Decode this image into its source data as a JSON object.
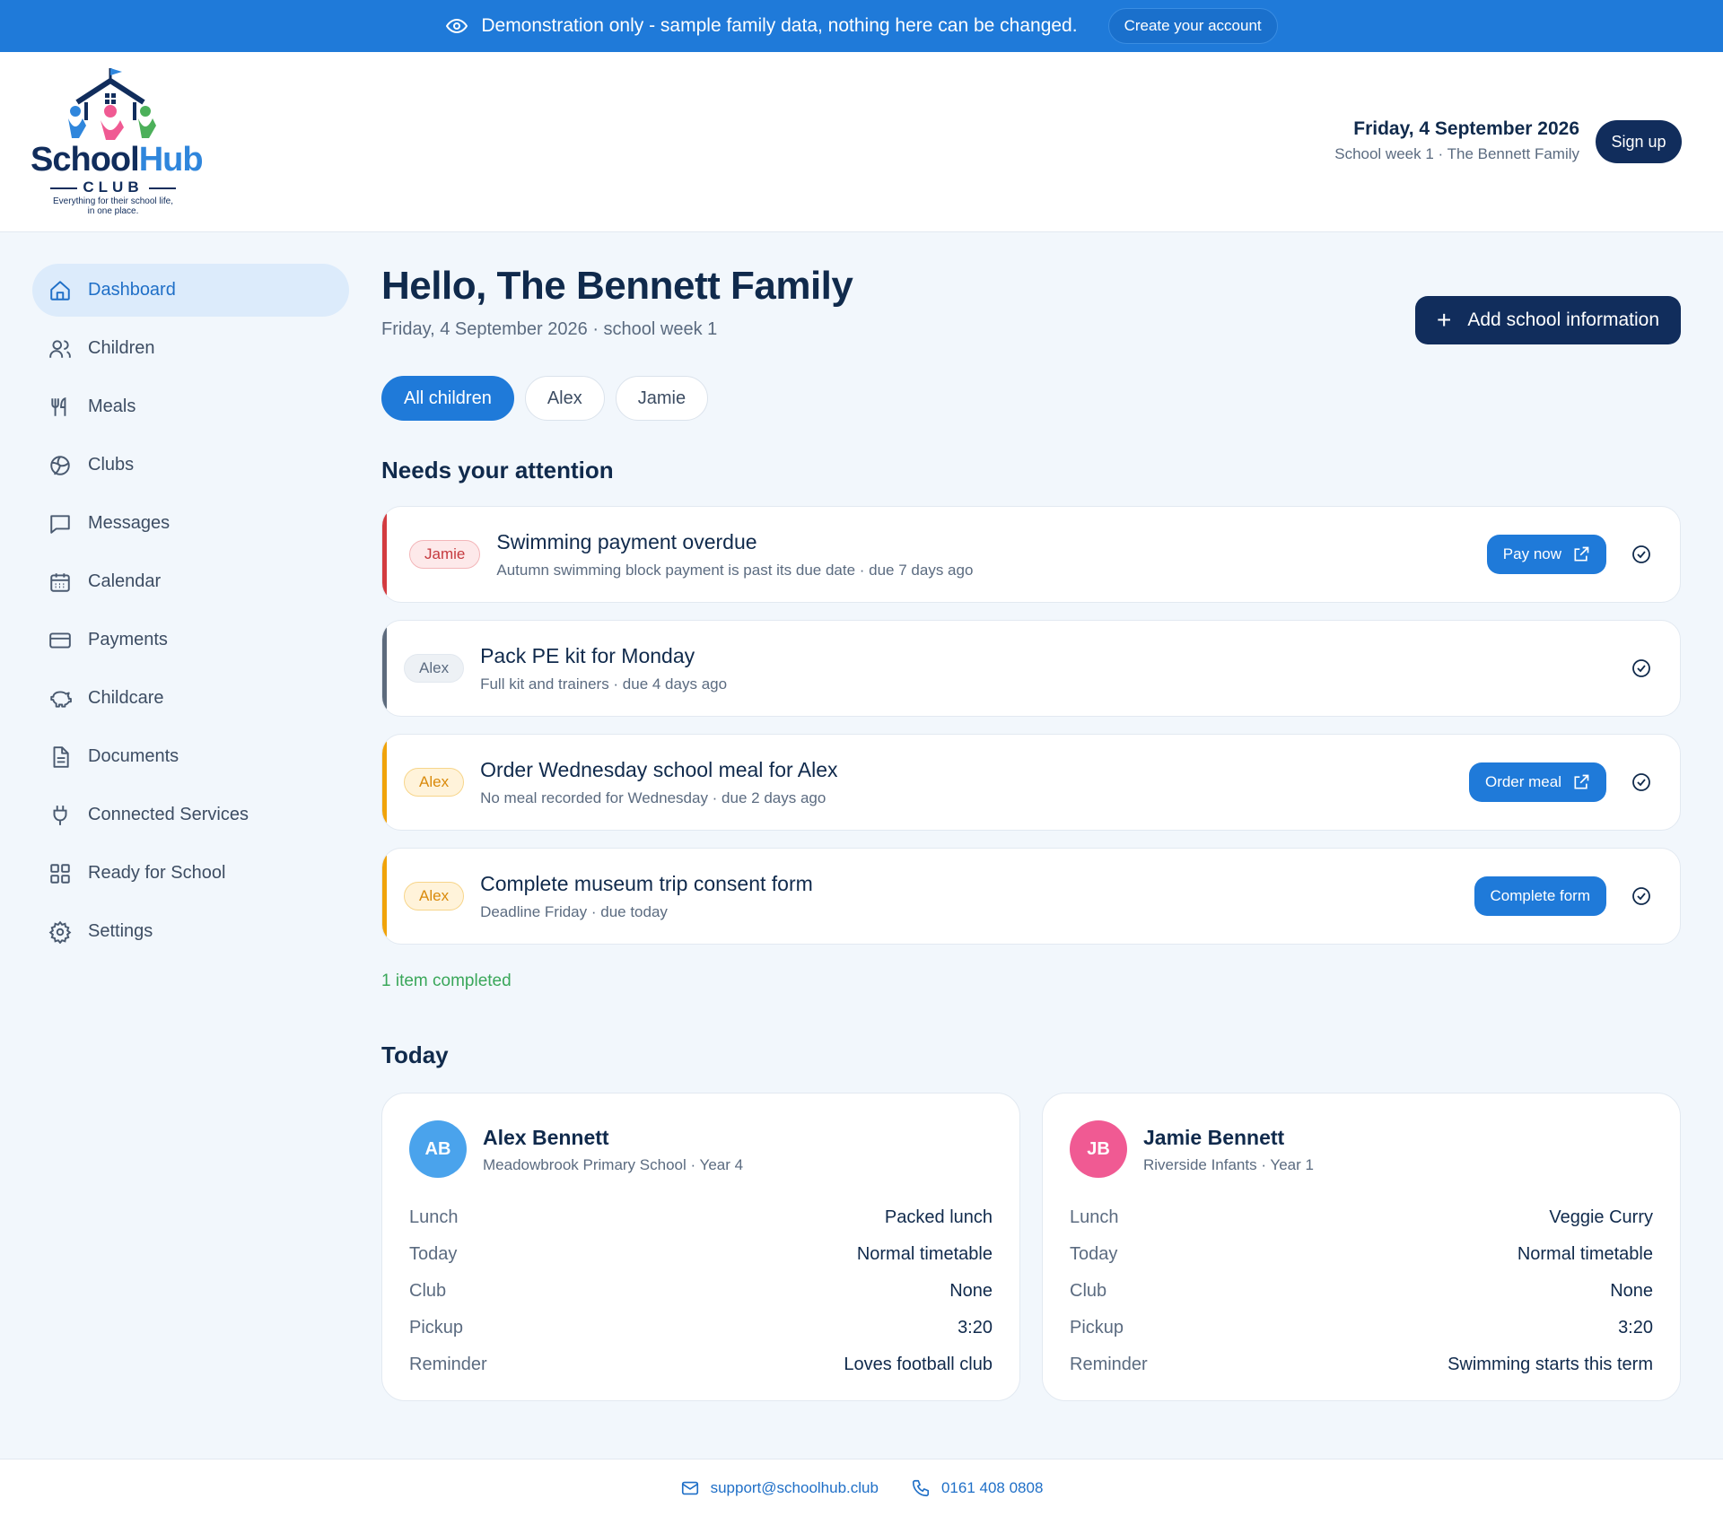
{
  "colors": {
    "banner": "#1f7ad9",
    "navy": "#112d5c",
    "accent": "#1f7ad9",
    "urgent": "#d33b40",
    "normal": "#5d6b7d",
    "warning": "#f0a30a",
    "success": "#3aa75a",
    "avatar_alex": "#4aa3ec",
    "avatar_jamie": "#f05a93"
  },
  "banner": {
    "icon": "eye-icon",
    "text": "Demonstration only - sample family data, nothing here can be changed.",
    "cta": "Create your account"
  },
  "logo": {
    "brand_a": "School",
    "brand_b": "Hub",
    "club": "CLUB",
    "tagline_line1": "Everything for their school life,",
    "tagline_line2": "in one place."
  },
  "header": {
    "date": "Friday, 4 September 2026",
    "subtitle": "School week 1 · The Bennett Family",
    "signup": "Sign up"
  },
  "sidebar": {
    "items": [
      {
        "label": "Dashboard",
        "icon": "home-icon"
      },
      {
        "label": "Children",
        "icon": "users-icon"
      },
      {
        "label": "Meals",
        "icon": "utensils-icon"
      },
      {
        "label": "Clubs",
        "icon": "ball-icon"
      },
      {
        "label": "Messages",
        "icon": "message-icon"
      },
      {
        "label": "Calendar",
        "icon": "calendar-icon"
      },
      {
        "label": "Payments",
        "icon": "card-icon"
      },
      {
        "label": "Childcare",
        "icon": "piggy-icon"
      },
      {
        "label": "Documents",
        "icon": "document-icon"
      },
      {
        "label": "Connected Services",
        "icon": "plug-icon"
      },
      {
        "label": "Ready for School",
        "icon": "grid-icon"
      },
      {
        "label": "Settings",
        "icon": "gear-icon"
      }
    ]
  },
  "main": {
    "greeting": "Hello, The Bennett Family",
    "date_line": "Friday, 4 September 2026 · school week 1",
    "add_button": "Add school information",
    "filters": [
      "All children",
      "Alex",
      "Jamie"
    ],
    "attention_title": "Needs your attention",
    "tasks": [
      {
        "child": "Jamie",
        "title": "Swimming payment overdue",
        "detail": "Autumn swimming block payment is past its due date · due 7 days ago",
        "action": "Pay now"
      },
      {
        "child": "Alex",
        "title": "Pack PE kit for Monday",
        "detail": "Full kit and trainers · due 4 days ago",
        "action": ""
      },
      {
        "child": "Alex",
        "title": "Order Wednesday school meal for Alex",
        "detail": "No meal recorded for Wednesday · due 2 days ago",
        "action": "Order meal"
      },
      {
        "child": "Alex",
        "title": "Complete museum trip consent form",
        "detail": "Deadline Friday · due today",
        "action": "Complete form"
      }
    ],
    "completed": "1 item completed",
    "today_title": "Today",
    "children": [
      {
        "initials": "AB",
        "name": "Alex Bennett",
        "school": "Meadowbrook Primary School · Year 4",
        "rows": [
          {
            "k": "Lunch",
            "v": "Packed lunch"
          },
          {
            "k": "Today",
            "v": "Normal timetable"
          },
          {
            "k": "Club",
            "v": "None"
          },
          {
            "k": "Pickup",
            "v": "3:20"
          },
          {
            "k": "Reminder",
            "v": "Loves football club"
          }
        ]
      },
      {
        "initials": "JB",
        "name": "Jamie Bennett",
        "school": "Riverside Infants · Year 1",
        "rows": [
          {
            "k": "Lunch",
            "v": "Veggie Curry"
          },
          {
            "k": "Today",
            "v": "Normal timetable"
          },
          {
            "k": "Club",
            "v": "None"
          },
          {
            "k": "Pickup",
            "v": "3:20"
          },
          {
            "k": "Reminder",
            "v": "Swimming starts this term"
          }
        ]
      }
    ]
  },
  "footer": {
    "email": "support@schoolhub.club",
    "phone": "0161 408 0808"
  }
}
